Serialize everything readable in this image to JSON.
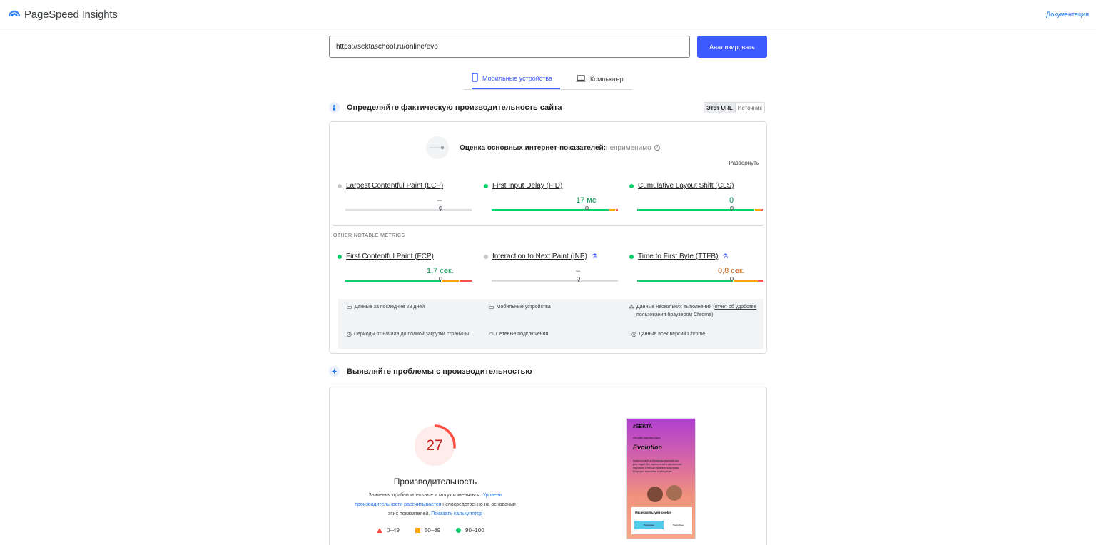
{
  "header": {
    "app_title": "PageSpeed Insights",
    "docs_link": "Документация"
  },
  "search": {
    "url_value": "https://sektaschool.ru/online/evo",
    "analyze_label": "Анализировать"
  },
  "device_tabs": [
    {
      "label": "Мобильные устройства",
      "active": true,
      "icon": "smartphone-icon"
    },
    {
      "label": "Компьютер",
      "active": false,
      "icon": "laptop-icon"
    }
  ],
  "field_section": {
    "title": "Определяйте фактическую производительность сайта",
    "toggle": {
      "this_url": "Этот URL",
      "origin": "Источник"
    },
    "assessment_label": "Оценка основных интернет-показателей:",
    "assessment_status": "неприменимо",
    "expand_label": "Развернуть",
    "core_metrics": [
      {
        "name": "Largest Contentful Paint (LCP)",
        "value": "–",
        "status": "grey",
        "distribution": null
      },
      {
        "name": "First Input Delay (FID)",
        "value": "17 мс",
        "status": "green",
        "distribution": [
          0.93,
          0.05,
          0.02
        ]
      },
      {
        "name": "Cumulative Layout Shift (CLS)",
        "value": "0",
        "status": "green",
        "distribution": [
          0.93,
          0.05,
          0.02
        ]
      }
    ],
    "other_label": "OTHER NOTABLE METRICS",
    "other_metrics": [
      {
        "name": "First Contentful Paint (FCP)",
        "value": "1,7 сек.",
        "status": "green",
        "experimental": false,
        "distribution": [
          0.76,
          0.14,
          0.1
        ]
      },
      {
        "name": "Interaction to Next Paint (INP)",
        "value": "–",
        "status": "grey",
        "experimental": true,
        "distribution": null
      },
      {
        "name": "Time to First Byte (TTFB)",
        "value": "0,8 сек.",
        "status": "green",
        "experimental": true,
        "distribution": [
          0.76,
          0.2,
          0.04
        ]
      }
    ],
    "info": {
      "period": "Данные за последние 28 дней",
      "device": "Мобильные устройства",
      "samples_prefix": "Данные нескольких выполнений (",
      "samples_link": "отчет об удобстве пользования браузером Chrome",
      "samples_suffix": ")",
      "duration": "Периоды от начала до полной загрузки страницы",
      "network": "Сетевые подключения",
      "versions": "Данные всех версий Chrome"
    }
  },
  "lab_section": {
    "title": "Выявляйте проблемы с производительностью",
    "score": 27,
    "score_label": "Производительность",
    "note_prefix": "Значения приблизительные и могут изменяться.",
    "note_link1": "Уровень производительности рассчитывается",
    "note_middle": "непосредственно на основании этих показателей.",
    "note_link2": "Показать калькулятор",
    "legend": [
      {
        "label": "0–49",
        "shape": "triangle",
        "color": "#ff4e42"
      },
      {
        "label": "50–89",
        "shape": "square",
        "color": "#ffa400"
      },
      {
        "label": "90–100",
        "shape": "circle",
        "color": "#0cce6b"
      }
    ]
  },
  "screenshot": {
    "brand": "#SEKTA",
    "subtitle": "Онлайн фитнес-курс",
    "title": "Evolution",
    "text": "Комплексный и сбалансированный курс для людей без ограничений в физических нагрузках с любым уровнем подготовки. Подходит мужчинам и женщинам.",
    "cookie_title": "Мы используем cookie",
    "cookie_accept": "Принимаю",
    "cookie_more": "Подробнее"
  },
  "colors": {
    "accent": "#3d5afe",
    "good": "#0cce6b",
    "average": "#ffa400",
    "poor": "#ff4e42",
    "score_text": "#c5221f"
  }
}
